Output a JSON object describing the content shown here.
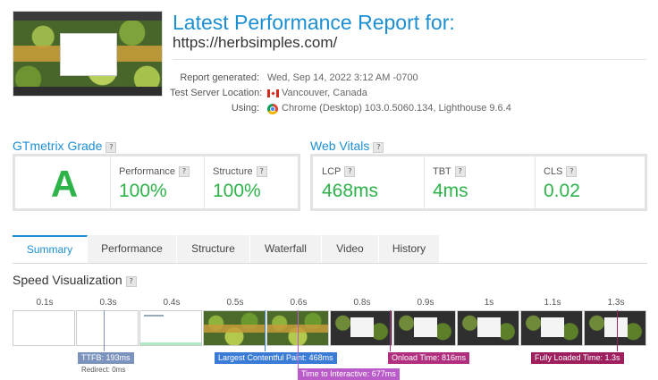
{
  "header": {
    "title": "Latest Performance Report for:",
    "url": "https://herbsimples.com/",
    "meta": [
      {
        "label": "Report generated:",
        "value": "Wed, Sep 14, 2022 3:12 AM -0700"
      },
      {
        "label": "Test Server Location:",
        "value": "Vancouver, Canada",
        "icon": "canada-flag-icon"
      },
      {
        "label": "Using:",
        "value": "Chrome (Desktop) 103.0.5060.134, Lighthouse 9.6.4",
        "icon": "chrome-icon"
      }
    ]
  },
  "grade": {
    "heading": "GTmetrix Grade",
    "letter": "A",
    "performance_label": "Performance",
    "performance_value": "100%",
    "structure_label": "Structure",
    "structure_value": "100%"
  },
  "vitals": {
    "heading": "Web Vitals",
    "items": [
      {
        "label": "LCP",
        "value": "468ms"
      },
      {
        "label": "TBT",
        "value": "4ms"
      },
      {
        "label": "CLS",
        "value": "0.02"
      }
    ]
  },
  "tabs": [
    {
      "label": "Summary",
      "active": true
    },
    {
      "label": "Performance"
    },
    {
      "label": "Structure"
    },
    {
      "label": "Waterfall"
    },
    {
      "label": "Video"
    },
    {
      "label": "History"
    }
  ],
  "speed": {
    "heading": "Speed Visualization",
    "times": [
      "0.1s",
      "0.3s",
      "0.4s",
      "0.5s",
      "0.6s",
      "0.8s",
      "0.9s",
      "1s",
      "1.1s",
      "1.3s"
    ],
    "markers": {
      "ttfb": "TTFB: 193ms",
      "redirect": "Redirect: 0ms",
      "lcp": "Largest Contentful Paint: 468ms",
      "tti": "Time to Interactive: 677ms",
      "onload": "Onload Time: 816ms",
      "fully_loaded": "Fully Loaded Time: 1.3s"
    },
    "colors": {
      "ttfb": "#7b93bd",
      "lcp": "#3a7bd5",
      "tti": "#b95bc9",
      "onload": "#b0307f",
      "fully_loaded": "#9e1f5e"
    }
  },
  "badge": "?"
}
